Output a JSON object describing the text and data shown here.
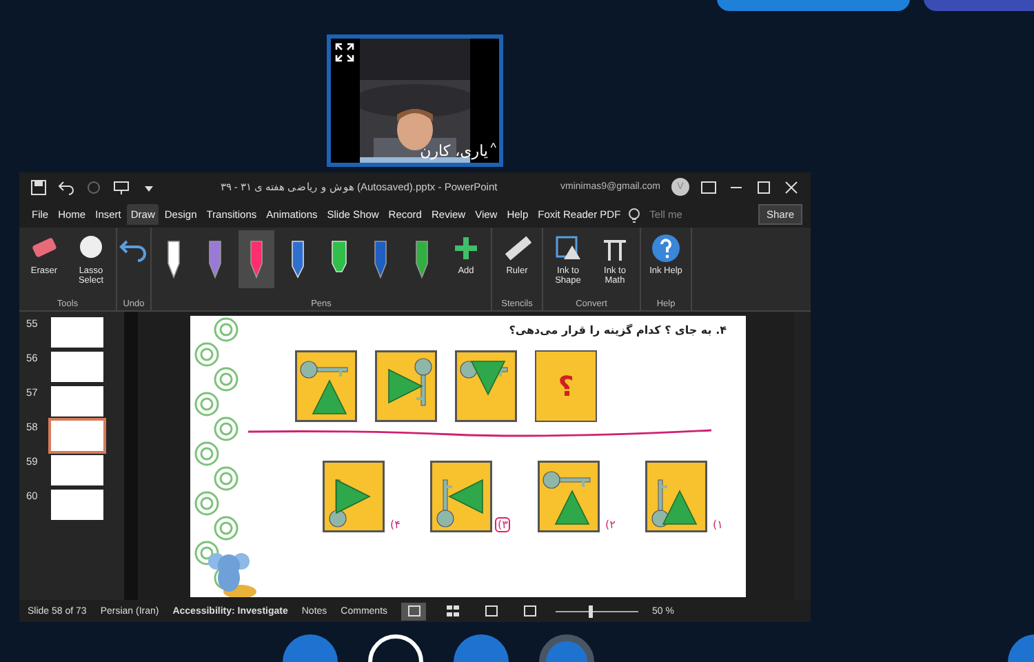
{
  "top_buttons": [
    {
      "color": "#1f80d9"
    },
    {
      "color": "#3b4db5"
    }
  ],
  "video": {
    "name": "یاری، کارن",
    "caret": "^"
  },
  "window": {
    "title": "هوش و ریاضی هفته ی ۳۱ - ۳۹ (Autosaved).pptx  -  PowerPoint",
    "account": "vminimas9@gmail.com",
    "avatar": "V",
    "menu": [
      {
        "label": "File",
        "selected": false
      },
      {
        "label": "Home",
        "selected": false
      },
      {
        "label": "Insert",
        "selected": false
      },
      {
        "label": "Draw",
        "selected": true
      },
      {
        "label": "Design",
        "selected": false
      },
      {
        "label": "Transitions",
        "selected": false
      },
      {
        "label": "Animations",
        "selected": false
      },
      {
        "label": "Slide Show",
        "selected": false
      },
      {
        "label": "Record",
        "selected": false
      },
      {
        "label": "Review",
        "selected": false
      },
      {
        "label": "View",
        "selected": false
      },
      {
        "label": "Help",
        "selected": false
      },
      {
        "label": "Foxit Reader PDF",
        "selected": false
      }
    ],
    "tell_me": "Tell me",
    "share": "Share"
  },
  "ribbon": [
    {
      "label": "Tools",
      "items": [
        {
          "kind": "eraser",
          "label": "Eraser"
        },
        {
          "kind": "lasso",
          "label": "Lasso Select"
        }
      ]
    },
    {
      "label": "Undo",
      "items": [
        {
          "kind": "undo"
        }
      ]
    },
    {
      "label": "Pens",
      "pens": [
        {
          "kind": "pen",
          "color": "#ffffff",
          "selected": false
        },
        {
          "kind": "pen",
          "color": "#9a7ad8",
          "selected": false
        },
        {
          "kind": "pen",
          "color": "#ff2e6e",
          "selected": true
        },
        {
          "kind": "pencil",
          "color": "#2f6fd0",
          "selected": false
        },
        {
          "kind": "highlighter",
          "color": "#2fbf4a",
          "selected": false
        },
        {
          "kind": "pen",
          "color": "#1f5fc0",
          "selected": false
        },
        {
          "kind": "pen",
          "color": "#30b040",
          "selected": false
        }
      ],
      "items": [
        {
          "kind": "add",
          "label": "Add"
        }
      ]
    },
    {
      "label": "Stencils",
      "items": [
        {
          "kind": "ruler",
          "label": "Ruler"
        }
      ]
    },
    {
      "label": "Convert",
      "items": [
        {
          "kind": "shape",
          "label": "Ink to Shape"
        },
        {
          "kind": "math",
          "label": "Ink to Math"
        }
      ]
    },
    {
      "label": "Help",
      "items": [
        {
          "kind": "help",
          "label": "Ink Help"
        }
      ]
    }
  ],
  "thumbnails": [
    {
      "number": "55",
      "selected": false
    },
    {
      "number": "56",
      "selected": false
    },
    {
      "number": "57",
      "selected": false
    },
    {
      "number": "58",
      "selected": true
    },
    {
      "number": "59",
      "selected": false
    },
    {
      "number": "60",
      "selected": false
    }
  ],
  "slide": {
    "question": "۴. به جای ؟ کدام گزینه را قرار می‌دهی؟",
    "cards": [
      {
        "kind": "figure"
      },
      {
        "kind": "figure"
      },
      {
        "kind": "figure"
      },
      {
        "kind": "question",
        "text": "؟"
      }
    ],
    "options": [
      {
        "label": "۱)",
        "selected": false
      },
      {
        "label": "۲)",
        "selected": false
      },
      {
        "label": "۳)",
        "selected": true
      },
      {
        "label": "۴)",
        "selected": false
      }
    ]
  },
  "status": {
    "slide": "Slide 58 of 73",
    "language": "Persian (Iran)",
    "accessibility": "Accessibility: Investigate",
    "notes": "Notes",
    "comments": "Comments",
    "views": [
      {
        "kind": "normal",
        "selected": true
      },
      {
        "kind": "sorter",
        "selected": false
      },
      {
        "kind": "reading",
        "selected": false
      },
      {
        "kind": "show",
        "selected": false
      }
    ],
    "zoom": {
      "level": 0.4,
      "text": "50 %"
    }
  },
  "dock": [
    {
      "kind": "filled"
    },
    {
      "kind": "outline"
    },
    {
      "kind": "filled"
    },
    {
      "kind": "ring"
    },
    {
      "kind": "filled"
    }
  ]
}
